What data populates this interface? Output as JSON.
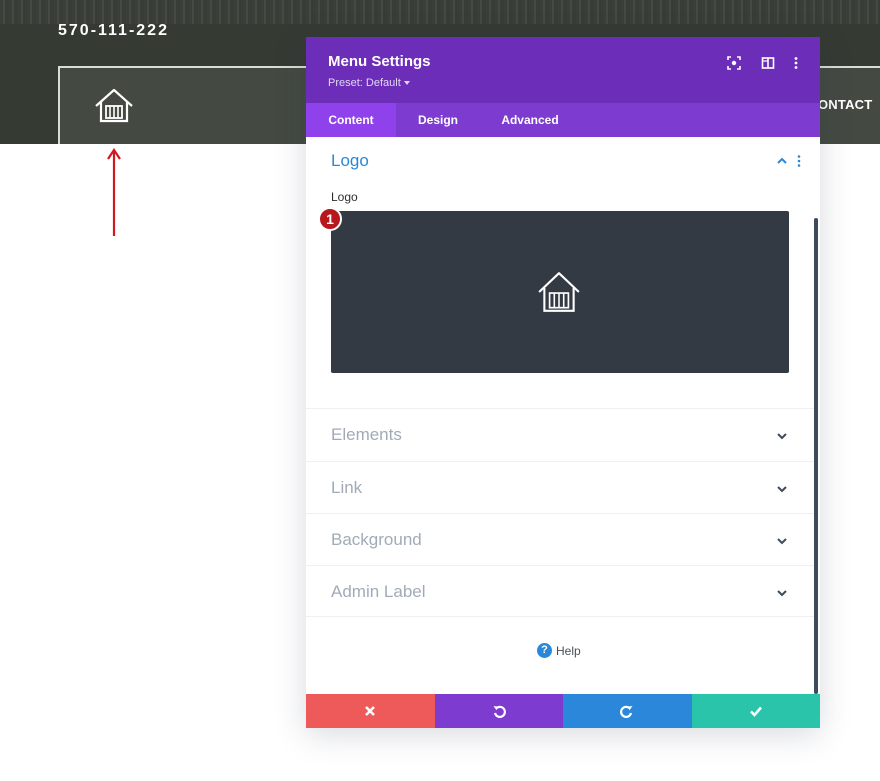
{
  "site": {
    "phone": "570-111-222",
    "nav_partial": "ONTACT"
  },
  "modal": {
    "title": "Menu Settings",
    "preset": "Preset: Default",
    "tabs": [
      {
        "label": "Content",
        "active": true
      },
      {
        "label": "Design",
        "active": false
      },
      {
        "label": "Advanced",
        "active": false
      }
    ],
    "open_section": {
      "title": "Logo",
      "field_label": "Logo",
      "badge": "1"
    },
    "collapsed_sections": [
      {
        "label": "Elements"
      },
      {
        "label": "Link"
      },
      {
        "label": "Background"
      },
      {
        "label": "Admin Label"
      }
    ],
    "help_label": "Help",
    "footer": {
      "cancel_color": "#ee5a5a",
      "undo_color": "#7e3bd0",
      "redo_color": "#2b87da",
      "save_color": "#29c4a9"
    }
  },
  "colors": {
    "header_purple": "#6c2eb9",
    "tab_bar": "#7e3bd0",
    "active_tab": "#8f42ec",
    "accent_blue": "#2b87da",
    "arrow_red": "#d0181e"
  }
}
